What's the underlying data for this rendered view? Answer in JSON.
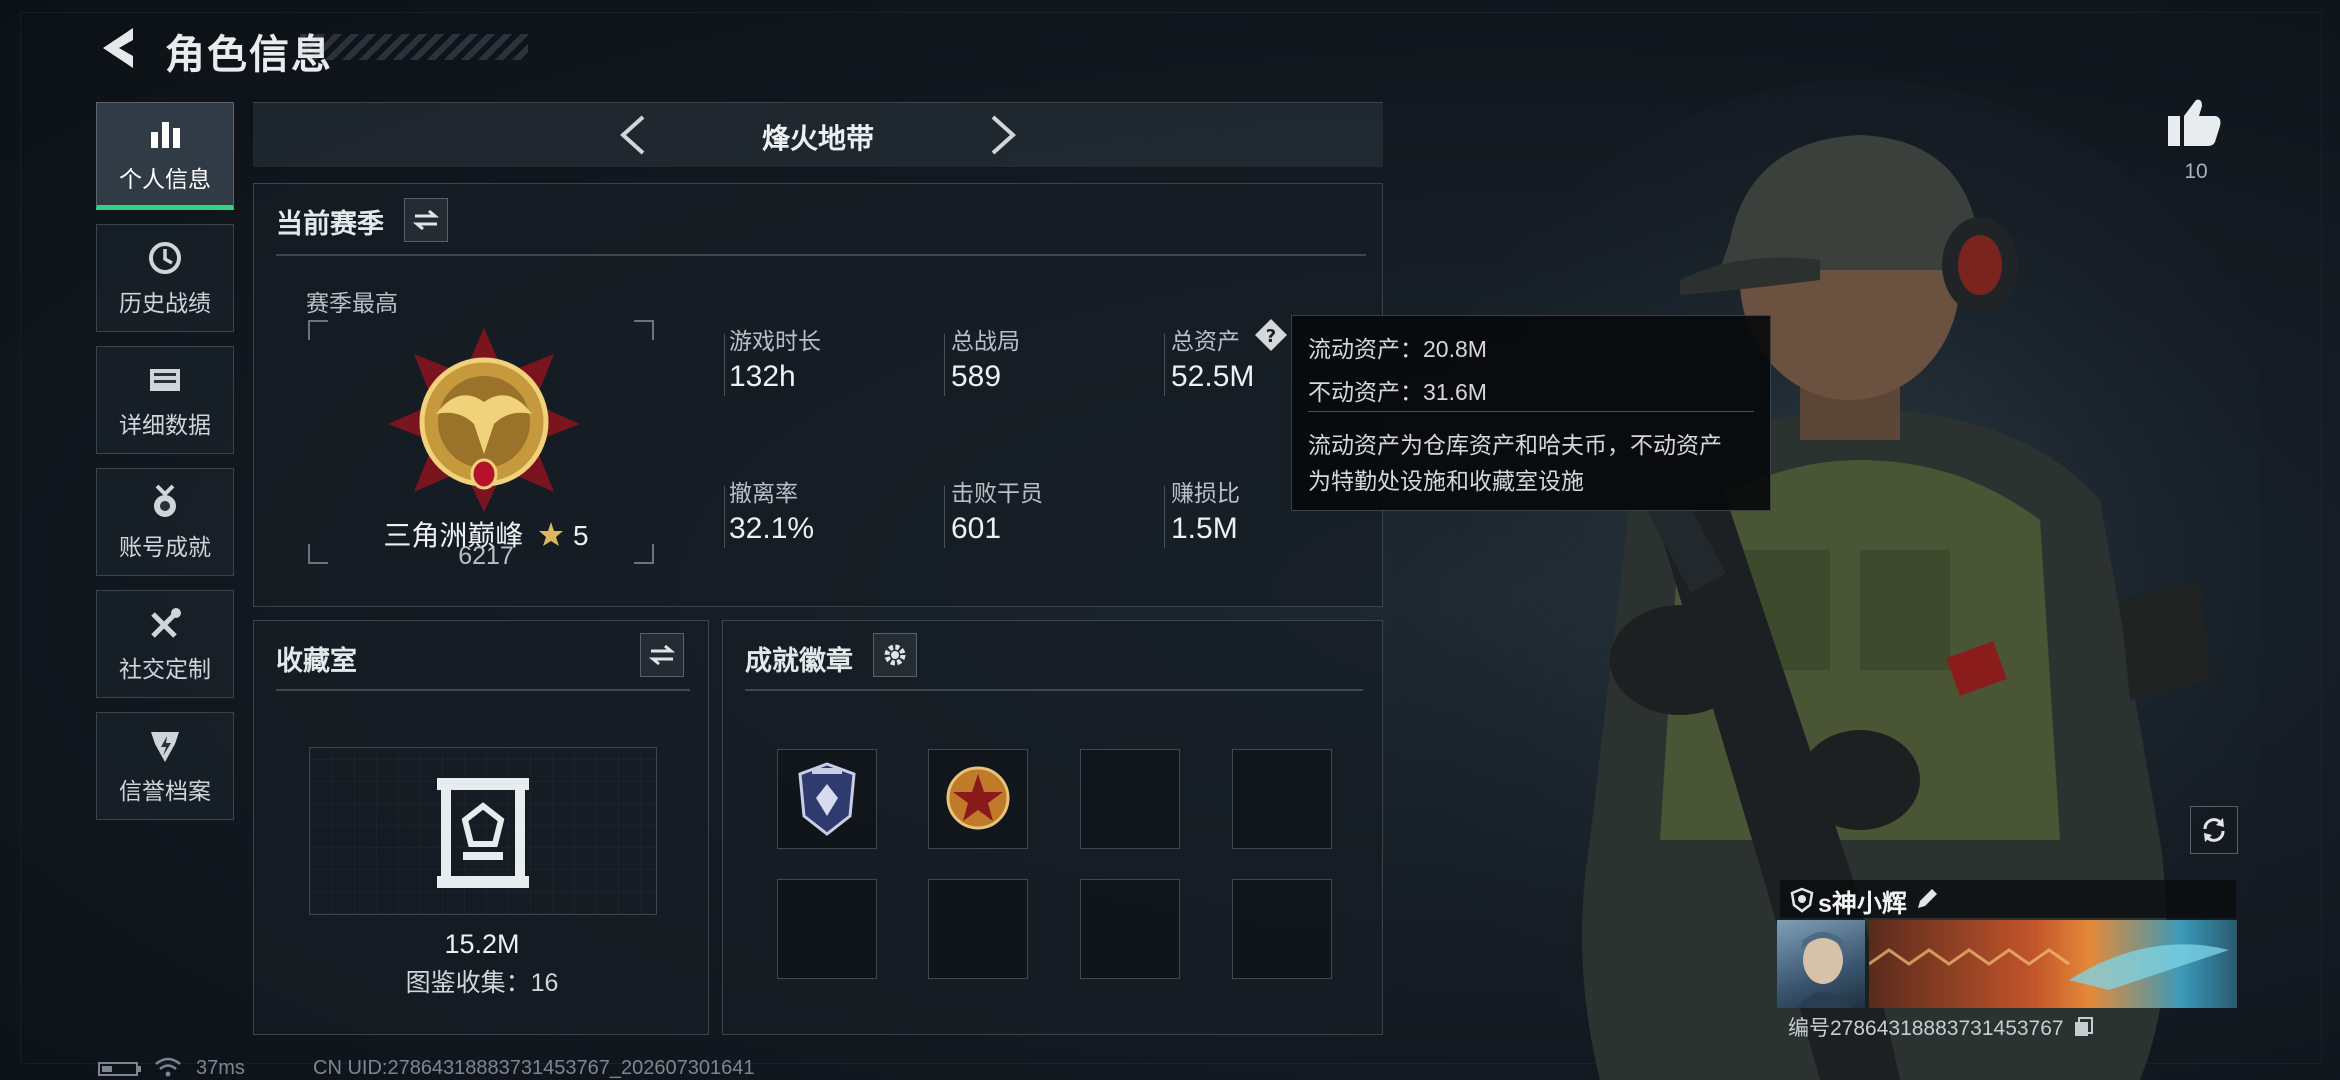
{
  "header": {
    "title": "角色信息"
  },
  "sidebar": {
    "items": [
      {
        "label": "个人信息",
        "icon": "bar-chart-icon",
        "active": true
      },
      {
        "label": "历史战绩",
        "icon": "history-clock-icon",
        "active": false
      },
      {
        "label": "详细数据",
        "icon": "folder-icon",
        "active": false
      },
      {
        "label": "账号成就",
        "icon": "medal-icon",
        "active": false
      },
      {
        "label": "社交定制",
        "icon": "tools-icon",
        "active": false
      },
      {
        "label": "信誉档案",
        "icon": "reputation-icon",
        "active": false
      }
    ]
  },
  "mode": {
    "name": "烽火地带"
  },
  "season": {
    "title": "当前赛季",
    "best_label": "赛季最高",
    "rank_name": "三角洲巅峰",
    "rank_stars": "5",
    "rank_score": "6217",
    "stats": [
      {
        "label": "游戏时长",
        "value": "132h"
      },
      {
        "label": "总战局",
        "value": "589"
      },
      {
        "label": "总资产",
        "value": "52.5M"
      },
      {
        "label": "撤离率",
        "value": "32.1%"
      },
      {
        "label": "击败干员",
        "value": "601"
      },
      {
        "label": "赚损比",
        "value": "1.5M"
      }
    ]
  },
  "tooltip": {
    "line1": "流动资产：20.8M",
    "line2": "不动资产：31.6M",
    "line3": "流动资产为仓库资产和哈夫币，不动资产",
    "line4": "为特勤处设施和收藏室设施"
  },
  "collection": {
    "title": "收藏室",
    "value": "15.2M",
    "catalog": "图鉴收集：16"
  },
  "achievements": {
    "title": "成就徽章"
  },
  "likes": {
    "count": "10"
  },
  "player": {
    "name": "s神小辉",
    "id": "编号2786431888373145376​7"
  },
  "status": {
    "ping": "37ms",
    "uid": "CN UID:2786431888373145376​7_202607301641"
  },
  "colors": {
    "accent_green": "#35d08a",
    "rank_red": "#9c1f2a",
    "gold": "#d4a84a"
  }
}
